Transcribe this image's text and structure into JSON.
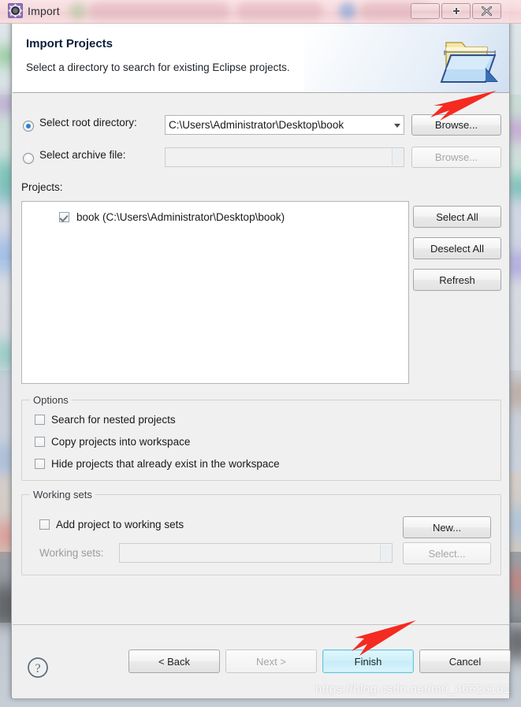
{
  "window": {
    "title": "Import",
    "icon": "eclipse-import-gear-icon",
    "controls": {
      "minimize_label": "",
      "maximize_label": "+",
      "close_label": "x"
    }
  },
  "banner": {
    "title": "Import Projects",
    "description": "Select a directory to search for existing Eclipse projects.",
    "icon": "import-folder-icon"
  },
  "source": {
    "root_directory": {
      "label": "Select root directory:",
      "selected": true,
      "value": "C:\\Users\\Administrator\\Desktop\\book",
      "browse_label": "Browse...",
      "browse_enabled": true
    },
    "archive_file": {
      "label": "Select archive file:",
      "selected": false,
      "value": "",
      "browse_label": "Browse...",
      "browse_enabled": false
    }
  },
  "projects": {
    "label": "Projects:",
    "items": [
      {
        "checked": true,
        "label": "book (C:\\Users\\Administrator\\Desktop\\book)"
      }
    ],
    "buttons": {
      "select_all": "Select All",
      "deselect_all": "Deselect All",
      "refresh": "Refresh"
    }
  },
  "options": {
    "title": "Options",
    "items": [
      {
        "label": "Search for nested projects",
        "checked": false
      },
      {
        "label": "Copy projects into workspace",
        "checked": false
      },
      {
        "label": "Hide projects that already exist in the workspace",
        "checked": false
      }
    ]
  },
  "working_sets": {
    "title": "Working sets",
    "add_checkbox": {
      "label": "Add project to working sets",
      "checked": false
    },
    "new_button": "New...",
    "field_label": "Working sets:",
    "field_value": "",
    "select_button": "Select...",
    "field_enabled": false,
    "select_enabled": false
  },
  "footer": {
    "help_icon": "question-mark-icon",
    "buttons": [
      {
        "label": "< Back",
        "enabled": true,
        "default": false
      },
      {
        "label": "Next >",
        "enabled": false,
        "default": false
      },
      {
        "label": "Finish",
        "enabled": true,
        "default": true
      },
      {
        "label": "Cancel",
        "enabled": true,
        "default": false
      }
    ]
  },
  "annotations": {
    "arrow_color": "#f52a21",
    "watermark": "https://blog.csdn.net/m0_46626161"
  }
}
